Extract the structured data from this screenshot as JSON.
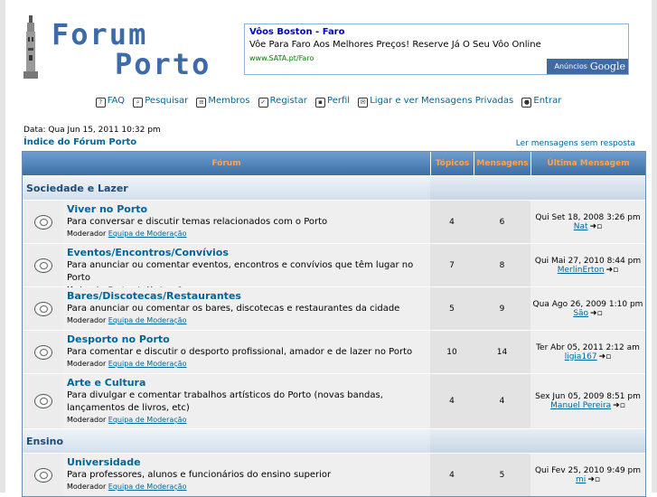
{
  "logo": {
    "line1": "Forum",
    "line2": "Porto"
  },
  "ad": {
    "title": "Vôos Boston - Faro",
    "text": "Vôe Para Faro Aos Melhores Preços! Reserve Já O Seu Vôo Online",
    "url": "www.SATA.pt/Faro",
    "badge_label": "Anúncios",
    "badge_brand": "Google"
  },
  "nav": [
    {
      "label": "FAQ",
      "icon": "?"
    },
    {
      "label": "Pesquisar",
      "icon": "⌕"
    },
    {
      "label": "Membros",
      "icon": "≡"
    },
    {
      "label": "Registar",
      "icon": "✓"
    },
    {
      "label": "Perfil",
      "icon": "▪"
    },
    {
      "label": "Ligar e ver Mensagens Privadas",
      "icon": "✉"
    },
    {
      "label": "Entrar",
      "icon": "●"
    }
  ],
  "date": "Data: Qua Jun 15, 2011 10:32 pm",
  "index_link": "Índice do Fórum Porto",
  "unread_link": "Ler mensagens sem resposta",
  "table": {
    "headers": {
      "forum": "Fórum",
      "topics": "Tópicos",
      "posts": "Mensagens",
      "last": "Última Mensagem"
    },
    "moderator_label": "Moderador",
    "moderator_link": "Equipa de Moderação",
    "categories": [
      {
        "name": "Sociedade e Lazer",
        "forums": [
          {
            "name": "Viver no Porto",
            "desc": "Para conversar e discutir temas relacionados com o Porto",
            "topics": "4",
            "posts": "6",
            "last_date": "Qui Set 18, 2008 3:26 pm",
            "last_user": "Nat"
          },
          {
            "name": "Eventos/Encontros/Convívios",
            "desc": "Para anunciar ou comentar eventos, encontros e convívios que têm lugar no Porto",
            "topics": "7",
            "posts": "8",
            "last_date": "Qui Mai 27, 2010 8:44 pm",
            "last_user": "MerlinErton"
          },
          {
            "name": "Bares/Discotecas/Restaurantes",
            "desc": "Para anunciar ou comentar os bares, discotecas e restaurantes da cidade",
            "topics": "5",
            "posts": "9",
            "last_date": "Qua Ago 26, 2009 1:10 pm",
            "last_user": "São"
          },
          {
            "name": "Desporto no Porto",
            "desc": "Para comentar e discutir o desporto profissional, amador e de lazer no Porto",
            "topics": "10",
            "posts": "14",
            "last_date": "Ter Abr 05, 2011 2:12 am",
            "last_user": "ligia167"
          },
          {
            "name": "Arte e Cultura",
            "desc": "Para divulgar e comentar trabalhos artísticos do Porto (novas bandas, lançamentos de livros, etc)",
            "topics": "4",
            "posts": "4",
            "last_date": "Sex Jun 05, 2009 8:51 pm",
            "last_user": "Manuel Pereira"
          }
        ]
      },
      {
        "name": "Ensino",
        "forums": [
          {
            "name": "Universidade",
            "desc": "Para professores, alunos e funcionários do ensino superior",
            "topics": "4",
            "posts": "5",
            "last_date": "Qui Fev 25, 2010 9:49 pm",
            "last_user": "mi"
          }
        ]
      }
    ]
  }
}
